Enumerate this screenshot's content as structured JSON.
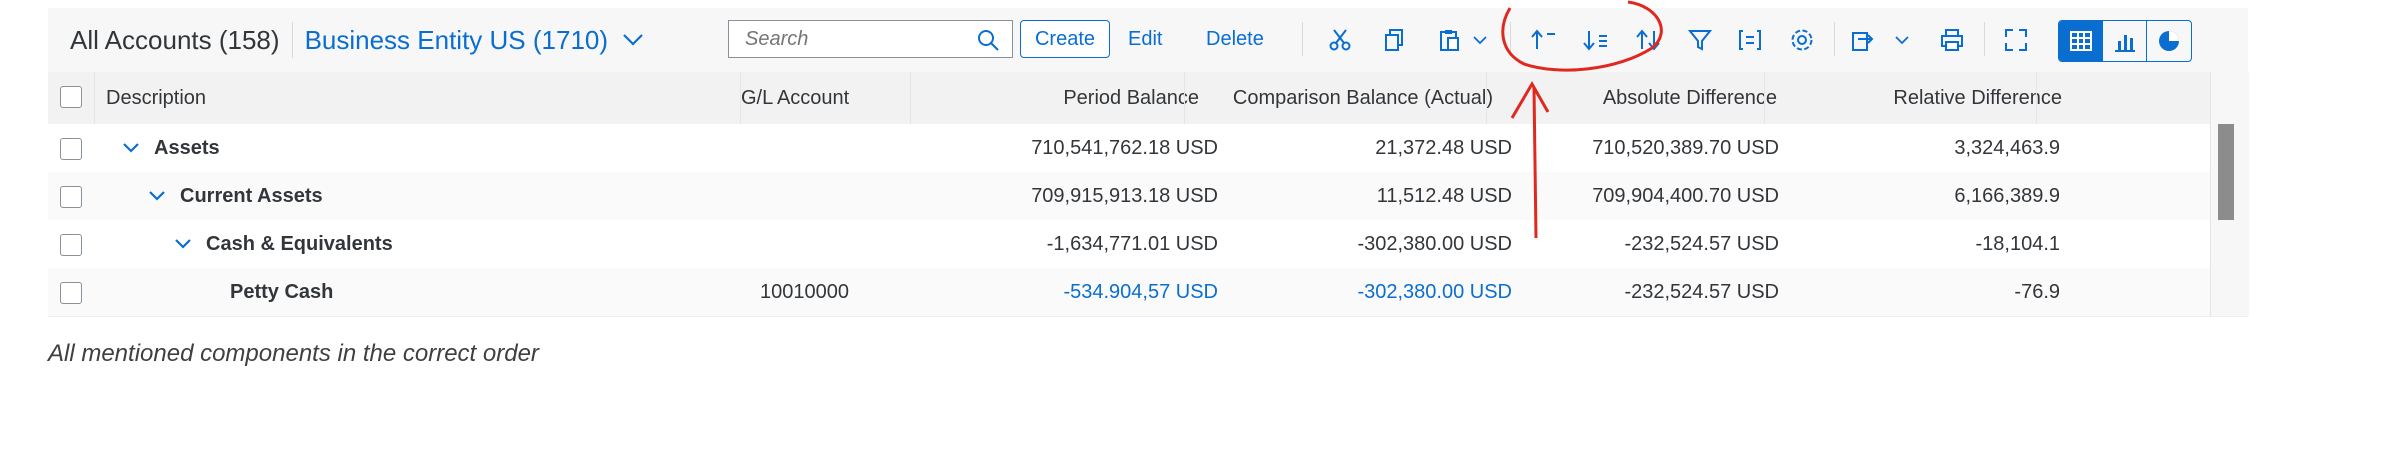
{
  "toolbar": {
    "accounts_title": "All Accounts (158)",
    "entity": "Business Entity US (1710)",
    "search_placeholder": "Search",
    "create_label": "Create",
    "edit_label": "Edit",
    "delete_label": "Delete",
    "icons": [
      "cut-icon",
      "copy-icon",
      "paste-icon",
      "sort-ascending-icon",
      "sort-descending-icon",
      "sort-icon",
      "filter-icon",
      "group-icon",
      "settings-icon",
      "export-icon",
      "print-icon",
      "fullscreen-icon",
      "table-view-icon",
      "bar-chart-view-icon",
      "pie-chart-view-icon"
    ]
  },
  "table": {
    "headers": [
      "Description",
      "G/L Account",
      "Period Balance",
      "Comparison Balance (Actual)",
      "Absolute Difference",
      "Relative Difference"
    ],
    "rows": [
      {
        "description": "Assets",
        "gl": "",
        "period": "710,541,762.18 USD",
        "comparison": "21,372.48 USD",
        "absolute": "710,520,389.70 USD",
        "relative": "3,324,463.9"
      },
      {
        "description": "Current Assets",
        "gl": "",
        "period": "709,915,913.18 USD",
        "comparison": "11,512.48 USD",
        "absolute": "709,904,400.70 USD",
        "relative": "6,166,389.9"
      },
      {
        "description": "Cash & Equivalents",
        "gl": "",
        "period": "-1,634,771.01 USD",
        "comparison": "-302,380.00 USD",
        "absolute": "-232,524.57 USD",
        "relative": "-18,104.1"
      },
      {
        "description": "Petty Cash",
        "gl": "10010000",
        "period": "-534.904,57 USD",
        "comparison": "-302,380.00 USD",
        "absolute": "-232,524.57 USD",
        "relative": "-76.9"
      }
    ]
  },
  "caption": "All mentioned components in the correct order",
  "colors": {
    "accent": "#0a6ed1",
    "annotation": "#e0281e"
  }
}
